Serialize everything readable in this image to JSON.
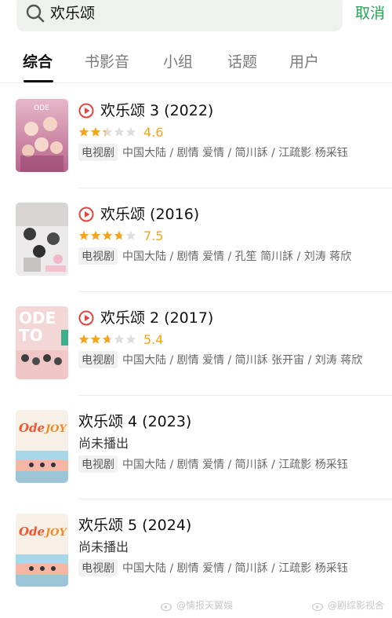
{
  "search": {
    "query": "欢乐颂",
    "cancel_label": "取消"
  },
  "tabs": [
    {
      "label": "综合"
    },
    {
      "label": "书影音"
    },
    {
      "label": "小组"
    },
    {
      "label": "话题"
    },
    {
      "label": "用户"
    }
  ],
  "results": [
    {
      "title": "欢乐颂 3 (2022)",
      "playable": true,
      "rating": 4.6,
      "score": "4.6",
      "type": "电视剧",
      "meta": "中国大陆 / 剧情 爱情 / 简川訸 / 江疏影 杨采钰"
    },
    {
      "title": "欢乐颂 (2016)",
      "playable": true,
      "rating": 7.5,
      "score": "7.5",
      "type": "电视剧",
      "meta": "中国大陆 / 剧情 爱情 / 孔笙 简川訸 / 刘涛 蒋欣"
    },
    {
      "title": "欢乐颂 2 (2017)",
      "playable": true,
      "rating": 5.4,
      "score": "5.4",
      "type": "电视剧",
      "meta": "中国大陆 / 剧情 爱情 / 简川訸 张开宙 / 刘涛 蒋欣"
    },
    {
      "title": "欢乐颂 4 (2023)",
      "playable": false,
      "pending": "尚未播出",
      "type": "电视剧",
      "meta": "中国大陆 / 剧情 爱情 / 简川訸 / 江疏影 杨采钰"
    },
    {
      "title": "欢乐颂 5 (2024)",
      "playable": false,
      "pending": "尚未播出",
      "type": "电视剧",
      "meta": "中国大陆 / 剧情 爱情 / 简川訸 / 江疏影 杨采钰"
    }
  ],
  "watermarks": [
    {
      "text": "@情报天翼娱"
    },
    {
      "text": "@剧综影视合"
    }
  ],
  "colors": {
    "accent": "#23a551",
    "star": "#f4a51c",
    "play": "#e0463f"
  }
}
